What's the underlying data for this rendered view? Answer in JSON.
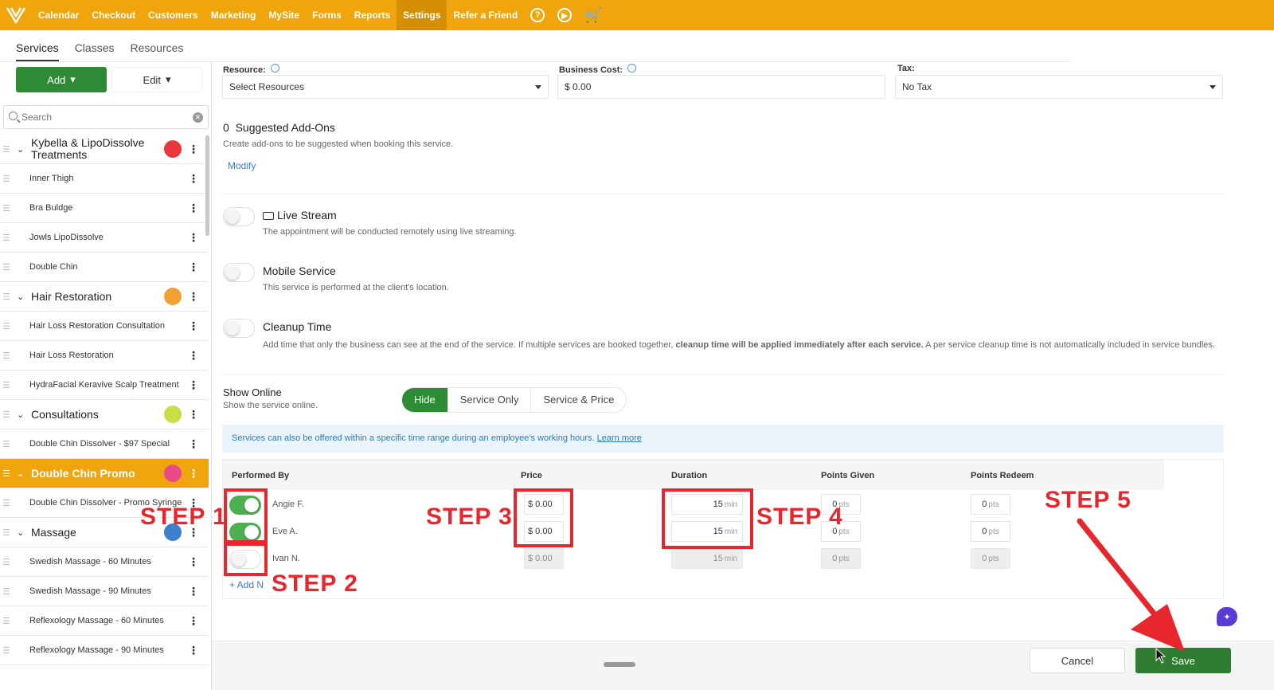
{
  "topnav": {
    "items": [
      "Calendar",
      "Checkout",
      "Customers",
      "Marketing",
      "MySite",
      "Forms",
      "Reports",
      "Settings",
      "Refer a Friend"
    ],
    "active_index": 7,
    "help_icon": "help-circle-icon",
    "play_icon": "play-circle-icon",
    "cart_icon": "cart-icon",
    "color": "#f1a50d"
  },
  "subtabs": {
    "items": [
      "Services",
      "Classes",
      "Resources"
    ],
    "active_index": 0
  },
  "sidebar": {
    "add_label": "Add",
    "edit_label": "Edit",
    "search_placeholder": "Search",
    "items": [
      {
        "type": "group",
        "label": "Kybella & LipoDissolve Treatments",
        "color": "#e8383d"
      },
      {
        "type": "item",
        "label": "Inner Thigh"
      },
      {
        "type": "item",
        "label": "Bra Buldge"
      },
      {
        "type": "item",
        "label": "Jowls LipoDissolve"
      },
      {
        "type": "item",
        "label": "Double Chin"
      },
      {
        "type": "group",
        "label": "Hair Restoration",
        "color": "#f5a033"
      },
      {
        "type": "item",
        "label": "Hair Loss Restoration Consultation"
      },
      {
        "type": "item",
        "label": "Hair Loss Restoration"
      },
      {
        "type": "item",
        "label": "HydraFacial Keravive Scalp Treatment"
      },
      {
        "type": "group",
        "label": "Consultations",
        "color": "#c8de44"
      },
      {
        "type": "item",
        "label": "Double Chin Dissolver - $97 Special"
      },
      {
        "type": "group",
        "label": "Double Chin Promo",
        "color": "#e84a8a",
        "selected": true
      },
      {
        "type": "item",
        "label": "Double Chin Dissolver - Promo Syringe"
      },
      {
        "type": "group",
        "label": "Massage",
        "color": "#3f7fd0"
      },
      {
        "type": "item",
        "label": "Swedish Massage - 60 Minutes"
      },
      {
        "type": "item",
        "label": "Swedish Massage - 90 Minutes"
      },
      {
        "type": "item",
        "label": "Reflexology Massage - 60 Minutes"
      },
      {
        "type": "item",
        "label": "Reflexology Massage - 90 Minutes"
      }
    ]
  },
  "form": {
    "resource_label": "Resource:",
    "resource_value": "Select Resources",
    "business_cost_label": "Business Cost:",
    "business_cost_value": "$ 0.00",
    "tax_label": "Tax:",
    "tax_value": "No Tax",
    "addons_count": "0",
    "addons_title": "Suggested Add-Ons",
    "addons_desc": "Create add-ons to be suggested when booking this service.",
    "addons_link": "Modify",
    "live_stream_title": "Live Stream",
    "live_stream_desc": "The appointment will be conducted remotely using live streaming.",
    "mobile_title": "Mobile Service",
    "mobile_desc": "This service is performed at the client's location.",
    "cleanup_title": "Cleanup Time",
    "cleanup_desc_1": "Add time that only the business can see at the end of the service. If multiple services are booked together, ",
    "cleanup_desc_bold": "cleanup time will be applied immediately after each service.",
    "cleanup_desc_2": " A per service cleanup time is not automatically included in service bundles.",
    "show_online_title": "Show Online",
    "show_online_desc": "Show the service online.",
    "show_online_options": [
      "Hide",
      "Service Only",
      "Service & Price"
    ],
    "show_online_active": 0,
    "banner_text": "Services can also be offered within a specific time range during an employee's working hours. ",
    "banner_link": "Learn more"
  },
  "employees": {
    "headers": [
      "Performed By",
      "Price",
      "Duration",
      "Points Given",
      "Points Redeem"
    ],
    "rows": [
      {
        "name": "Angie F.",
        "enabled": true,
        "price": "$ 0.00",
        "duration": "15",
        "points_given": "0",
        "points_redeem": "0"
      },
      {
        "name": "Eve A.",
        "enabled": true,
        "price": "$ 0.00",
        "duration": "15",
        "points_given": "0",
        "points_redeem": "0"
      },
      {
        "name": "Ivan N.",
        "enabled": false,
        "price": "$ 0.00",
        "duration": "15",
        "points_given": "0",
        "points_redeem": "0"
      }
    ],
    "min_unit": "min",
    "pts_unit": "pts",
    "add_label": "+ Add N"
  },
  "footer": {
    "cancel_label": "Cancel",
    "save_label": "Save"
  },
  "annotations": {
    "steps": [
      "STEP 1",
      "STEP 2",
      "STEP 3",
      "STEP 4",
      "STEP 5"
    ],
    "color": "#e8262d"
  }
}
